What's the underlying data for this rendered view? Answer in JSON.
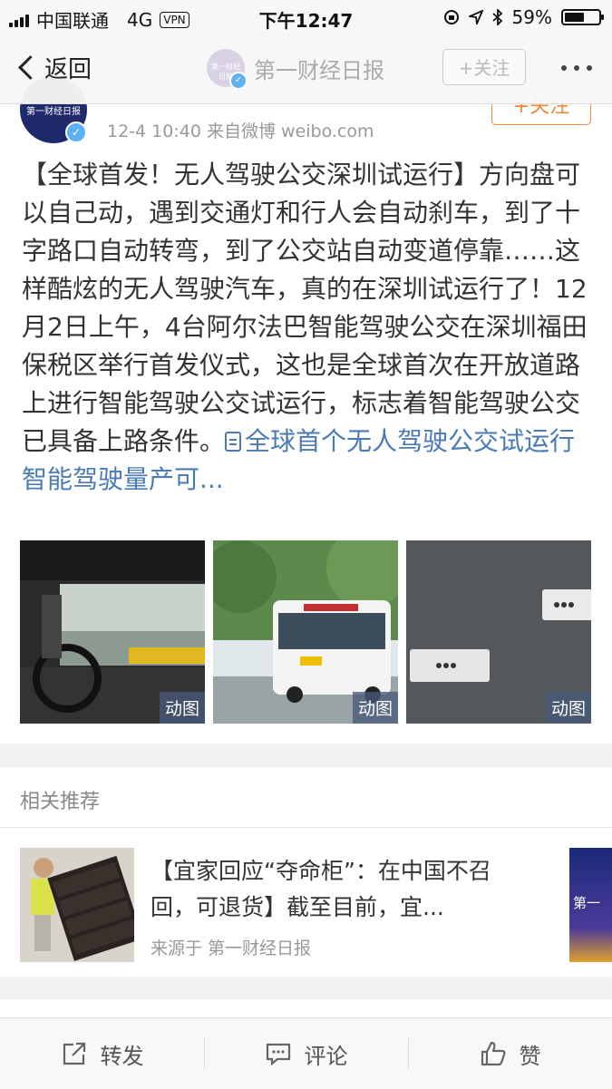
{
  "status_bar": {
    "carrier": "中国联通",
    "network": "4G",
    "vpn": "VPN",
    "time": "下午12:47",
    "battery_percent": "59%",
    "battery_level": 0.59
  },
  "nav": {
    "back_label": "返回",
    "title": "第一财经日报",
    "follow_label": "+关注",
    "avatar_text": "第一财经日报"
  },
  "post": {
    "avatar_text": "第一财经日报",
    "follow_label": "+关注",
    "meta": "12-4 10:40   来自微博 weibo.com",
    "body": "【全球首发！无人驾驶公交深圳试运行】方向盘可以自己动，遇到交通灯和行人会自动刹车，到了十字路口自动转弯，到了公交站自动变道停靠……这样酷炫的无人驾驶汽车，真的在深圳试运行了！12月2日上午，4台阿尔法巴智能驾驶公交在深圳福田保税区举行首发仪式，这也是全球首次在开放道路上进行智能驾驶公交试运行，标志着智能驾驶公交已具备上路条件。",
    "link_text": "全球首个无人驾驶公交试运行 智能驾驶量产可...",
    "images": [
      {
        "badge": "动图"
      },
      {
        "badge": "动图"
      },
      {
        "badge": "动图"
      }
    ]
  },
  "related": {
    "header": "相关推荐",
    "item_title": "【宜家回应“夺命柜”：在中国不召回，可退货】截至目前，宜...",
    "item_source": "来源于 第一财经日报",
    "side_thumb_text": "第一"
  },
  "toolbar": {
    "repost": "转发",
    "comment": "评论",
    "like": "赞"
  },
  "colors": {
    "link": "#4a7bb4",
    "follow_orange": "#f08a3c",
    "verify_badge": "#5db1f2"
  }
}
